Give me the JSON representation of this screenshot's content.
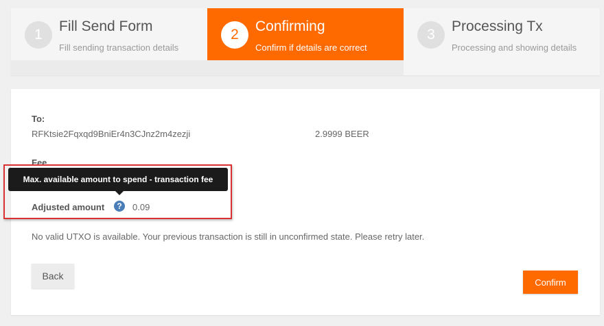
{
  "steps": [
    {
      "number": "1",
      "title": "Fill Send Form",
      "subtitle": "Fill sending transaction details"
    },
    {
      "number": "2",
      "title": "Confirming",
      "subtitle": "Confirm if details are correct"
    },
    {
      "number": "3",
      "title": "Processing Tx",
      "subtitle": "Processing and showing details"
    }
  ],
  "form": {
    "to_label": "To:",
    "to_address": "RFKtsie2Fqxqd9BniEr4n3CJnz2m4zezji",
    "to_amount": "2.9999 BEER",
    "fee_label": "Fee",
    "adjusted_label": "Adjusted amount",
    "adjusted_value": "0.09",
    "help_glyph": "?",
    "error_message": "No valid UTXO is available. Your previous transaction is still in unconfirmed state. Please retry later."
  },
  "tooltip": {
    "text": "Max. available amount to spend - transaction fee"
  },
  "buttons": {
    "back": "Back",
    "confirm": "Confirm"
  },
  "colors": {
    "accent": "#ff6a00",
    "help_icon": "#4a7eb8",
    "highlight": "#d93030"
  }
}
